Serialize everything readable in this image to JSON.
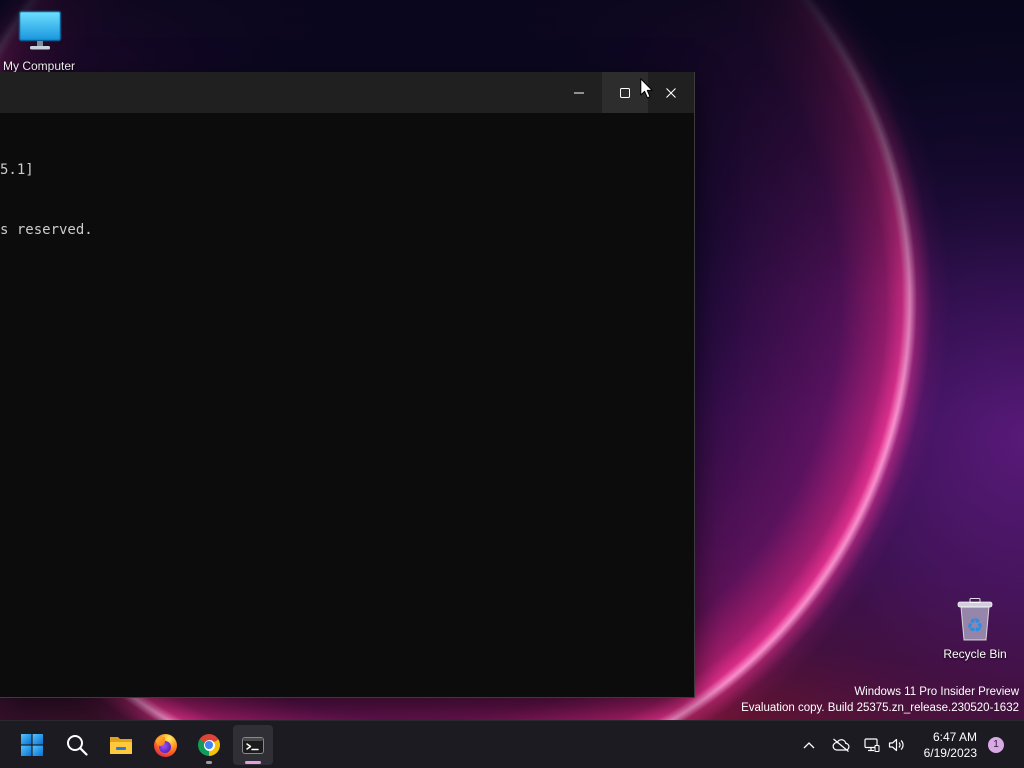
{
  "desktop": {
    "my_computer": {
      "label": "My Computer",
      "icon": "computer-monitor-icon"
    },
    "recycle_bin": {
      "label": "Recycle Bin",
      "icon": "recycle-bin-icon"
    },
    "watermark": {
      "edition": "Windows 11 Pro Insider Preview",
      "build": "Evaluation copy. Build 25375.zn_release.230520-1632"
    }
  },
  "terminal_window": {
    "output_lines": [
      "5.1]",
      "s reserved."
    ],
    "controls": [
      {
        "icon": "minimize-icon",
        "hovered": false
      },
      {
        "icon": "maximize-icon",
        "hovered": true
      },
      {
        "icon": "close-icon",
        "hovered": false
      }
    ]
  },
  "taskbar": {
    "apps": [
      {
        "icon": "windows-start-icon",
        "running": false,
        "active": false
      },
      {
        "icon": "search-icon",
        "running": false,
        "active": false
      },
      {
        "icon": "file-explorer-icon",
        "running": false,
        "active": false
      },
      {
        "icon": "firefox-icon",
        "running": false,
        "active": false
      },
      {
        "icon": "chrome-icon",
        "running": true,
        "active": false
      },
      {
        "icon": "terminal-icon",
        "running": true,
        "active": true
      }
    ],
    "tray": {
      "icons": [
        "chevron-up-icon",
        "cloud-off-icon",
        "network-icon",
        "volume-icon"
      ],
      "time": "6:47 AM",
      "date": "6/19/2023",
      "notification_count": "1"
    }
  },
  "cursor": {
    "icon": "arrow-cursor-icon"
  },
  "colors": {
    "terminal_bg": "#0c0c0c",
    "titlebar_bg": "#202020",
    "titlebar_hover": "#2d2d2d",
    "terminal_text": "#cccccc",
    "taskbar_bg": "#1c1b22",
    "active_indicator": "#e39ee1",
    "running_indicator": "#9c9c9c",
    "notification_badge": "#d9a9e6",
    "desktop_text": "#ffffff"
  }
}
